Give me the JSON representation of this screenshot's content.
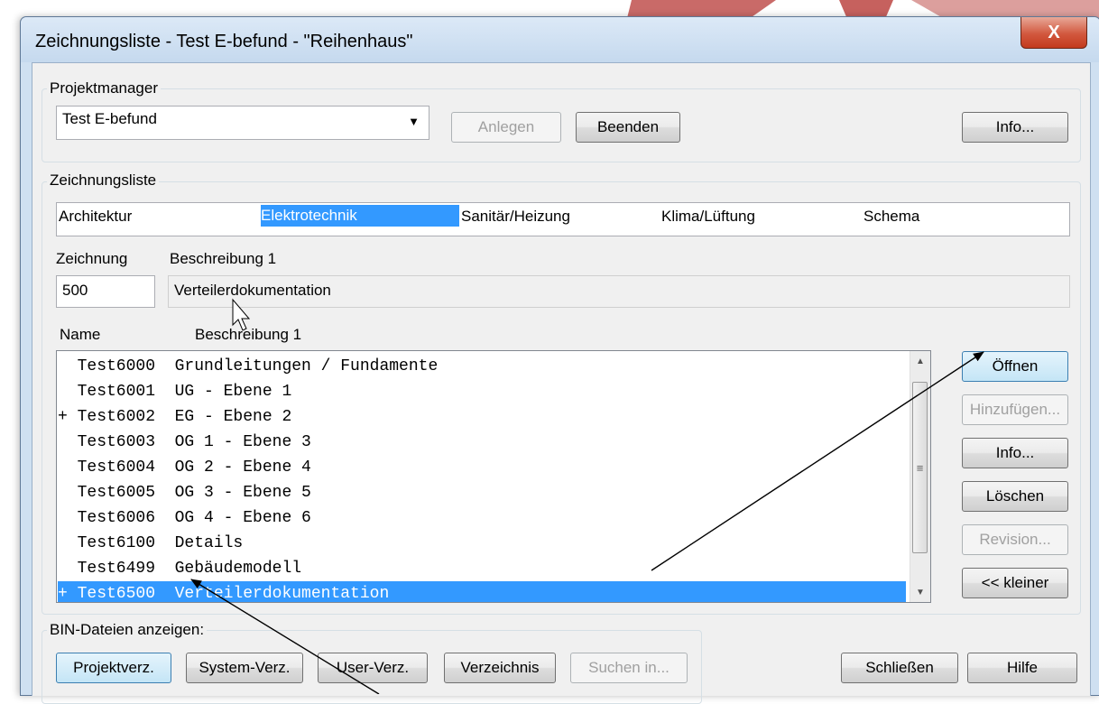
{
  "window": {
    "title": "Zeichnungsliste - Test E-befund - \"Reihenhaus\"",
    "close_glyph": "X"
  },
  "projektmanager": {
    "group_label": "Projektmanager",
    "project_value": "Test E-befund",
    "dropdown_glyph": "▼",
    "anlegen_label": "Anlegen",
    "beenden_label": "Beenden",
    "info_label": "Info..."
  },
  "zeichnungsliste": {
    "group_label": "Zeichnungsliste",
    "tabs": [
      {
        "label": "Architektur"
      },
      {
        "label": "Elektrotechnik"
      },
      {
        "label": "Sanitär/Heizung"
      },
      {
        "label": "Klima/Lüftung"
      },
      {
        "label": "Schema"
      }
    ],
    "selected_tab": "Elektrotechnik",
    "zeichnung_label": "Zeichnung",
    "beschreibung_label": "Beschreibung 1",
    "zeichnung_value": "500",
    "beschreibung_value": "Verteilerdokumentation",
    "list_header_name": "Name",
    "list_header_beschreibung": "Beschreibung 1",
    "rows": [
      {
        "text": "  Test6000  Grundleitungen / Fundamente"
      },
      {
        "text": "  Test6001  UG - Ebene 1"
      },
      {
        "text": "+ Test6002  EG - Ebene 2"
      },
      {
        "text": "  Test6003  OG 1 - Ebene 3"
      },
      {
        "text": "  Test6004  OG 2 - Ebene 4"
      },
      {
        "text": "  Test6005  OG 3 - Ebene 5"
      },
      {
        "text": "  Test6006  OG 4 - Ebene 6"
      },
      {
        "text": "  Test6100  Details"
      },
      {
        "text": "  Test6499  Gebäudemodell"
      },
      {
        "text": "+ Test6500  Verteilerdokumentation"
      }
    ],
    "selected_row": "Test6500",
    "scroll_up_glyph": "▲",
    "scroll_down_glyph": "▼",
    "scroll_grip_glyph": "≡"
  },
  "side_buttons": {
    "oeffnen_label": "Öffnen",
    "hinzufuegen_label": "Hinzufügen...",
    "info_label": "Info...",
    "loeschen_label": "Löschen",
    "revision_label": "Revision...",
    "kleiner_label": "<< kleiner"
  },
  "bin": {
    "group_label": "BIN-Dateien anzeigen:",
    "projektverz_label": "Projektverz.",
    "systemverz_label": "System-Verz.",
    "userverz_label": "User-Verz.",
    "verzeichnis_label": "Verzeichnis",
    "suchen_label": "Suchen in..."
  },
  "footer": {
    "schliessen_label": "Schließen",
    "hilfe_label": "Hilfe"
  },
  "colors": {
    "selection": "#3399ff",
    "window_frame": "#cfe0f1",
    "close_button": "#c94b31",
    "background_decoration": "#c0504d"
  }
}
